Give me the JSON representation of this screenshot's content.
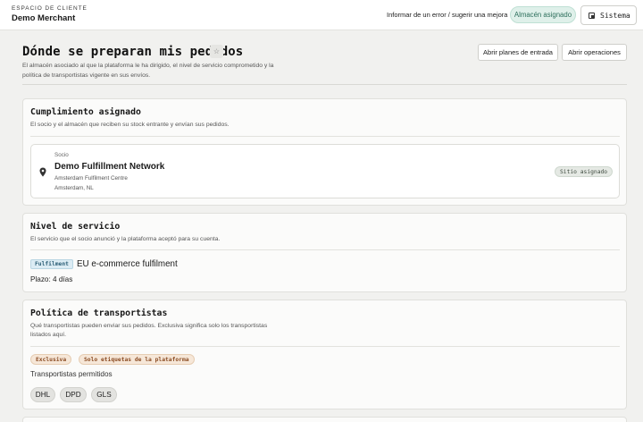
{
  "header": {
    "eyebrow": "ESPACIO DE CLIENTE",
    "merchant": "Demo Merchant",
    "report_link": "Informar de un error / sugerir una mejora",
    "assigned_pill": "Almacén asignado",
    "system_button": "Sistema",
    "system_icon": "theme-toggle-icon"
  },
  "page": {
    "title": "Dónde se preparan mis pedidos",
    "favorite_icon": "star-icon",
    "favorite_glyph": "☆",
    "description": "El almacén asociado al que la plataforma le ha dirigido, el nivel de servicio comprometido y la política de transportistas vigente en sus envíos.",
    "buttons": {
      "inbound": "Abrir planes de entrada",
      "operations": "Abrir operaciones"
    }
  },
  "fulfilment": {
    "title": "Cumplimiento asignado",
    "subtitle": "El socio y el almacén que reciben su stock entrante y envían sus pedidos.",
    "partner": {
      "label": "Socio",
      "name": "Demo Fulfillment Network",
      "site": "Amsterdam Fulfilment Centre",
      "location": "Amsterdam, NL",
      "badge": "Sitio asignado",
      "icon": "map-pin-icon"
    }
  },
  "service_level": {
    "title": "Nivel de servicio",
    "subtitle": "El servicio que el socio anunció y la plataforma aceptó para su cuenta.",
    "badge": "Fulfilment",
    "name": "EU e-commerce fulfilment",
    "lead_time": "Plazo: 4 días"
  },
  "carrier_policy": {
    "title": "Política de transportistas",
    "subtitle": "Qué transportistas pueden enviar sus pedidos. Exclusiva significa solo los transportistas listados aquí.",
    "tags": [
      "Exclusiva",
      "Solo etiquetas de la plataforma"
    ],
    "allowed_label": "Transportistas permitidos",
    "carriers": [
      "DHL",
      "DPD",
      "GLS"
    ]
  },
  "colors": {
    "accent_green": "#2d6f5c",
    "badge_blue": "#2c5f77",
    "tag_orange": "#8a4b22",
    "page_bg": "#f1f1ef"
  }
}
